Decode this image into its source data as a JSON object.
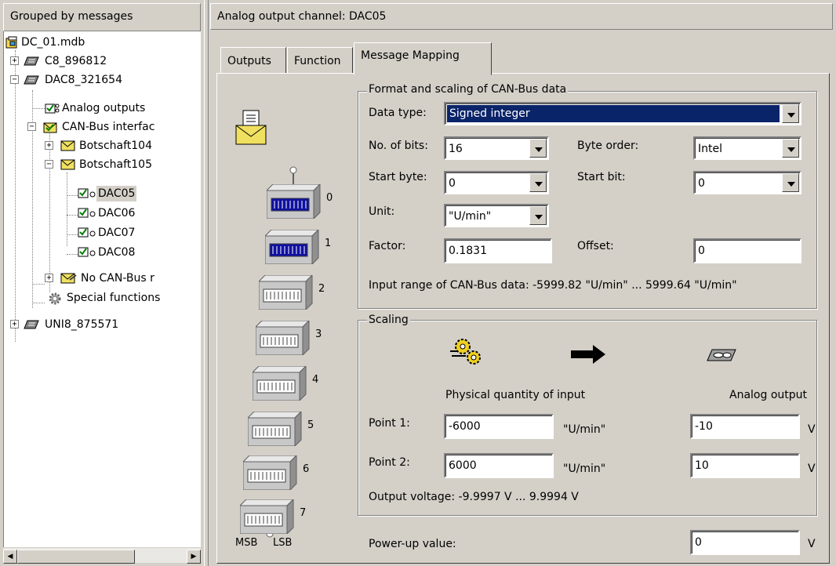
{
  "tree": {
    "header": "Grouped by messages",
    "items": [
      {
        "label": "DC_01.mdb"
      },
      {
        "label": "C8_896812"
      },
      {
        "label": "DAC8_321654"
      },
      {
        "label": "Analog outputs"
      },
      {
        "label": "CAN-Bus interfac"
      },
      {
        "label": "Botschaft104"
      },
      {
        "label": "Botschaft105"
      },
      {
        "label": "DAC05"
      },
      {
        "label": "DAC06"
      },
      {
        "label": "DAC07"
      },
      {
        "label": "DAC08"
      },
      {
        "label": "No CAN-Bus r"
      },
      {
        "label": "Special functions"
      },
      {
        "label": "UNI8_875571"
      }
    ]
  },
  "panel": {
    "header": "Analog output channel: DAC05",
    "tabs": [
      "Outputs",
      "Function",
      "Message Mapping"
    ],
    "active_tab": "Message Mapping"
  },
  "format": {
    "title": "Format and scaling of CAN-Bus data",
    "data_type_label": "Data type:",
    "data_type_value": "Signed integer",
    "bits_label": "No. of bits:",
    "bits_value": "16",
    "byte_order_label": "Byte order:",
    "byte_order_value": "Intel",
    "start_byte_label": "Start byte:",
    "start_byte_value": "0",
    "start_bit_label": "Start bit:",
    "start_bit_value": "0",
    "unit_label": "Unit:",
    "unit_value": "\"U/min\"",
    "factor_label": "Factor:",
    "factor_value": "0.1831",
    "offset_label": "Offset:",
    "offset_value": "0",
    "input_range": "Input range of CAN-Bus data: -5999.82 \"U/min\" ... 5999.64 \"U/min\""
  },
  "scaling": {
    "title": "Scaling",
    "phys_header": "Physical quantity of input",
    "analog_header": "Analog output",
    "point1_label": "Point 1:",
    "point1_phys": "-6000",
    "point1_unit": "\"U/min\"",
    "point1_out": "-10",
    "point1_v": "V",
    "point2_label": "Point 2:",
    "point2_phys": "6000",
    "point2_unit": "\"U/min\"",
    "point2_out": "10",
    "point2_v": "V",
    "output_voltage": "Output voltage: -9.9997 V ... 9.9994 V"
  },
  "powerup": {
    "label": "Power-up value:",
    "value": "0",
    "unit": "V"
  },
  "bytes": {
    "numbers": [
      "0",
      "1",
      "2",
      "3",
      "4",
      "5",
      "6",
      "7"
    ],
    "msb": "MSB",
    "lsb": "LSB"
  }
}
